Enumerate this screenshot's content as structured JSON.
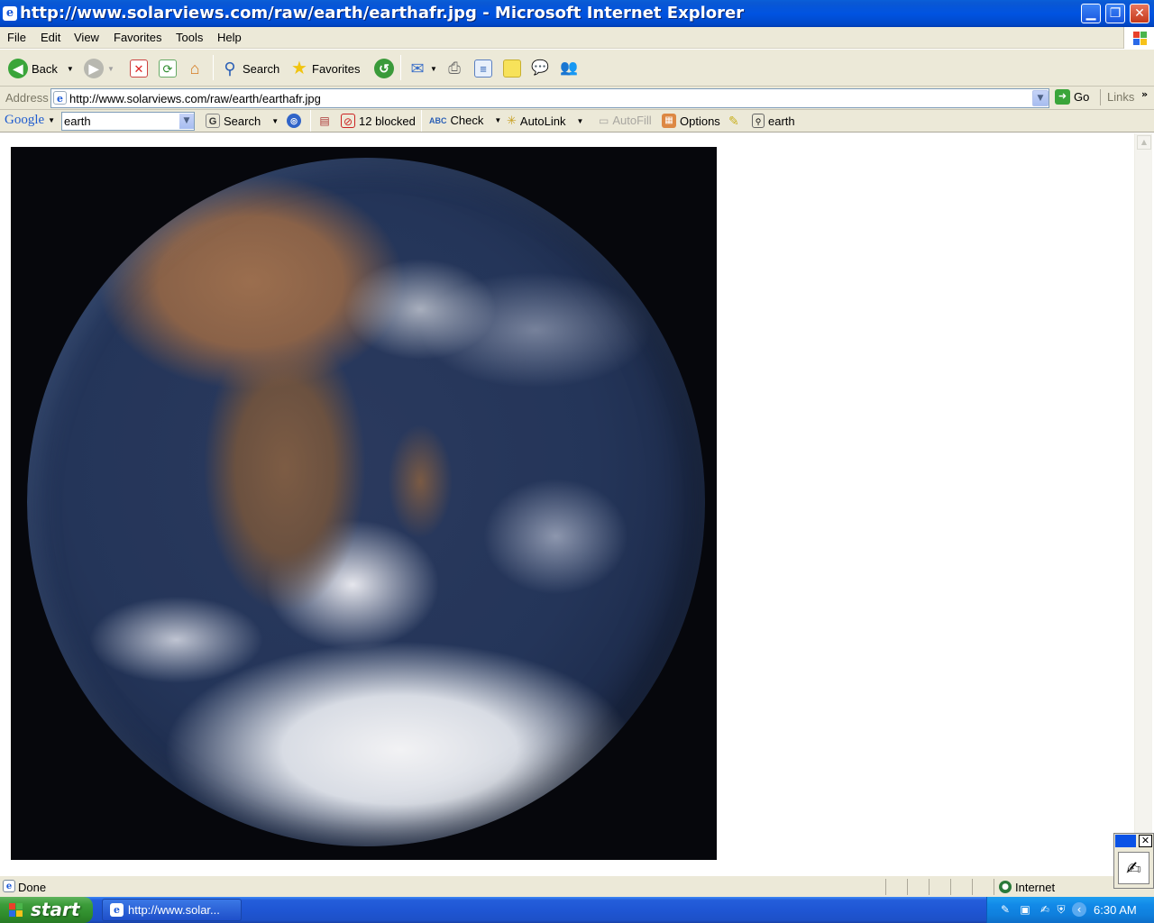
{
  "window": {
    "title": "http://www.solarviews.com/raw/earth/earthafr.jpg - Microsoft Internet Explorer"
  },
  "menu": [
    "File",
    "Edit",
    "View",
    "Favorites",
    "Tools",
    "Help"
  ],
  "toolbar": {
    "back_label": "Back",
    "search_label": "Search",
    "favorites_label": "Favorites"
  },
  "address": {
    "label": "Address",
    "url": "http://www.solarviews.com/raw/earth/earthafr.jpg",
    "go_label": "Go",
    "links_label": "Links"
  },
  "google_toolbar": {
    "logo": "Google",
    "query": "earth",
    "search_label": "Search",
    "blocked_label": "12 blocked",
    "check_label": "Check",
    "autolink_label": "AutoLink",
    "autofill_label": "AutoFill",
    "options_label": "Options",
    "highlight_term": "earth"
  },
  "content": {
    "image_name": "earthafr.jpg"
  },
  "status": {
    "text": "Done",
    "zone": "Internet"
  },
  "taskbar": {
    "start_label": "start",
    "window_button": "http://www.solar...",
    "clock": "6:30 AM"
  },
  "colors": {
    "titlebar": "#0053e1",
    "chrome": "#ece9d8",
    "taskbar": "#245edb",
    "start": "#3c9c3a",
    "tray": "#128ae8"
  }
}
